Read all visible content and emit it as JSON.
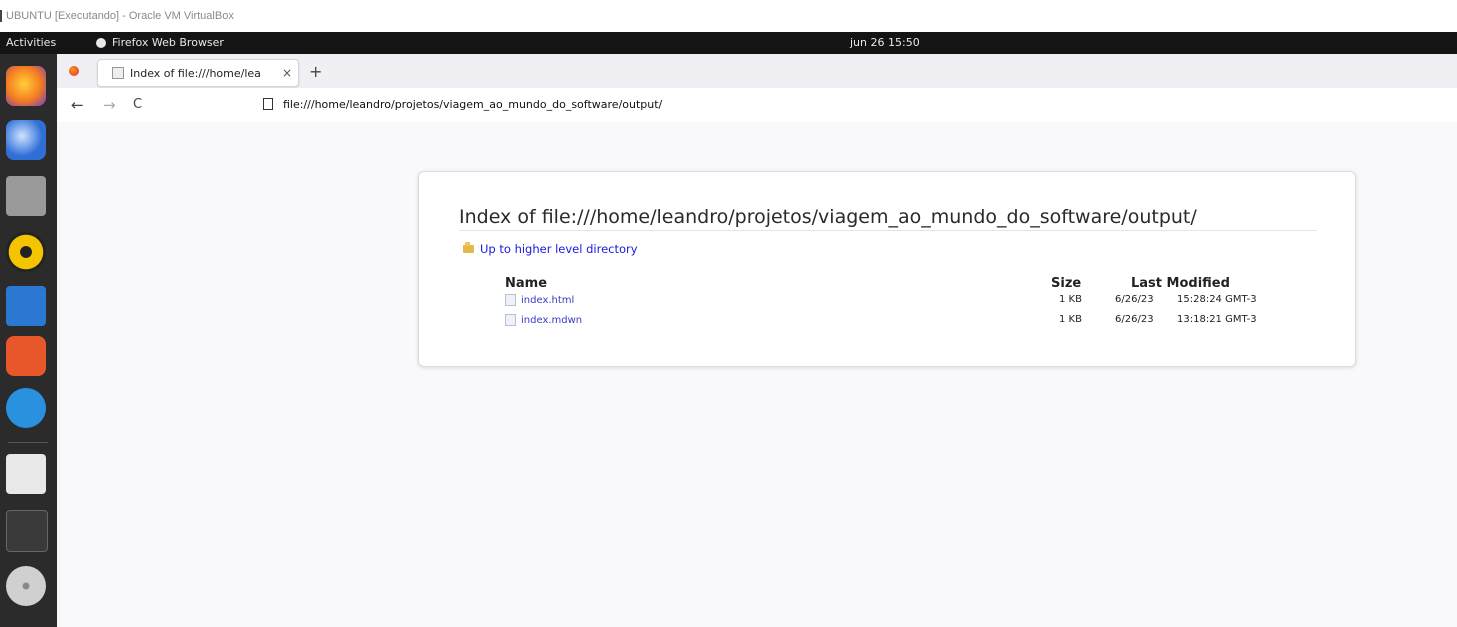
{
  "vbox": {
    "title": "UBUNTU [Executando] - Oracle VM VirtualBox"
  },
  "topbar": {
    "activities": "Activities",
    "app_name": "Firefox Web Browser",
    "clock": "jun 26  15:50"
  },
  "dock": {
    "items": [
      {
        "name": "firefox-icon",
        "color": "#f47b20"
      },
      {
        "name": "thunderbird-icon",
        "color": "#2f6fd6"
      },
      {
        "name": "files-icon",
        "color": "#9a9a9a"
      },
      {
        "name": "rhythmbox-icon",
        "color": "#f5c400"
      },
      {
        "name": "writer-icon",
        "color": "#2a78d2"
      },
      {
        "name": "software-icon",
        "color": "#e8572a"
      },
      {
        "name": "help-icon",
        "color": "#2a90e0"
      },
      {
        "name": "text-editor-icon",
        "color": "#e8e8e8"
      },
      {
        "name": "terminal-icon",
        "color": "#3a3a3a"
      },
      {
        "name": "disc-icon",
        "color": "#d0d0d0"
      }
    ]
  },
  "browser": {
    "tab": {
      "label": "Index of file:///home/lea",
      "close": "×"
    },
    "new_tab": "+",
    "nav": {
      "back": "←",
      "forward": "→",
      "reload": "C"
    },
    "url": "file:///home/leandro/projetos/viagem_ao_mundo_do_software/output/"
  },
  "page": {
    "title": "Index of file:///home/leandro/projetos/viagem_ao_mundo_do_software/output/",
    "up_link": "Up to higher level directory",
    "headers": {
      "name": "Name",
      "size": "Size",
      "modified": "Last Modified"
    },
    "files": [
      {
        "name": "index.html",
        "size": "1 KB",
        "date": "6/26/23",
        "time": "15:28:24 GMT-3"
      },
      {
        "name": "index.mdwn",
        "size": "1 KB",
        "date": "6/26/23",
        "time": "13:18:21 GMT-3"
      }
    ]
  }
}
